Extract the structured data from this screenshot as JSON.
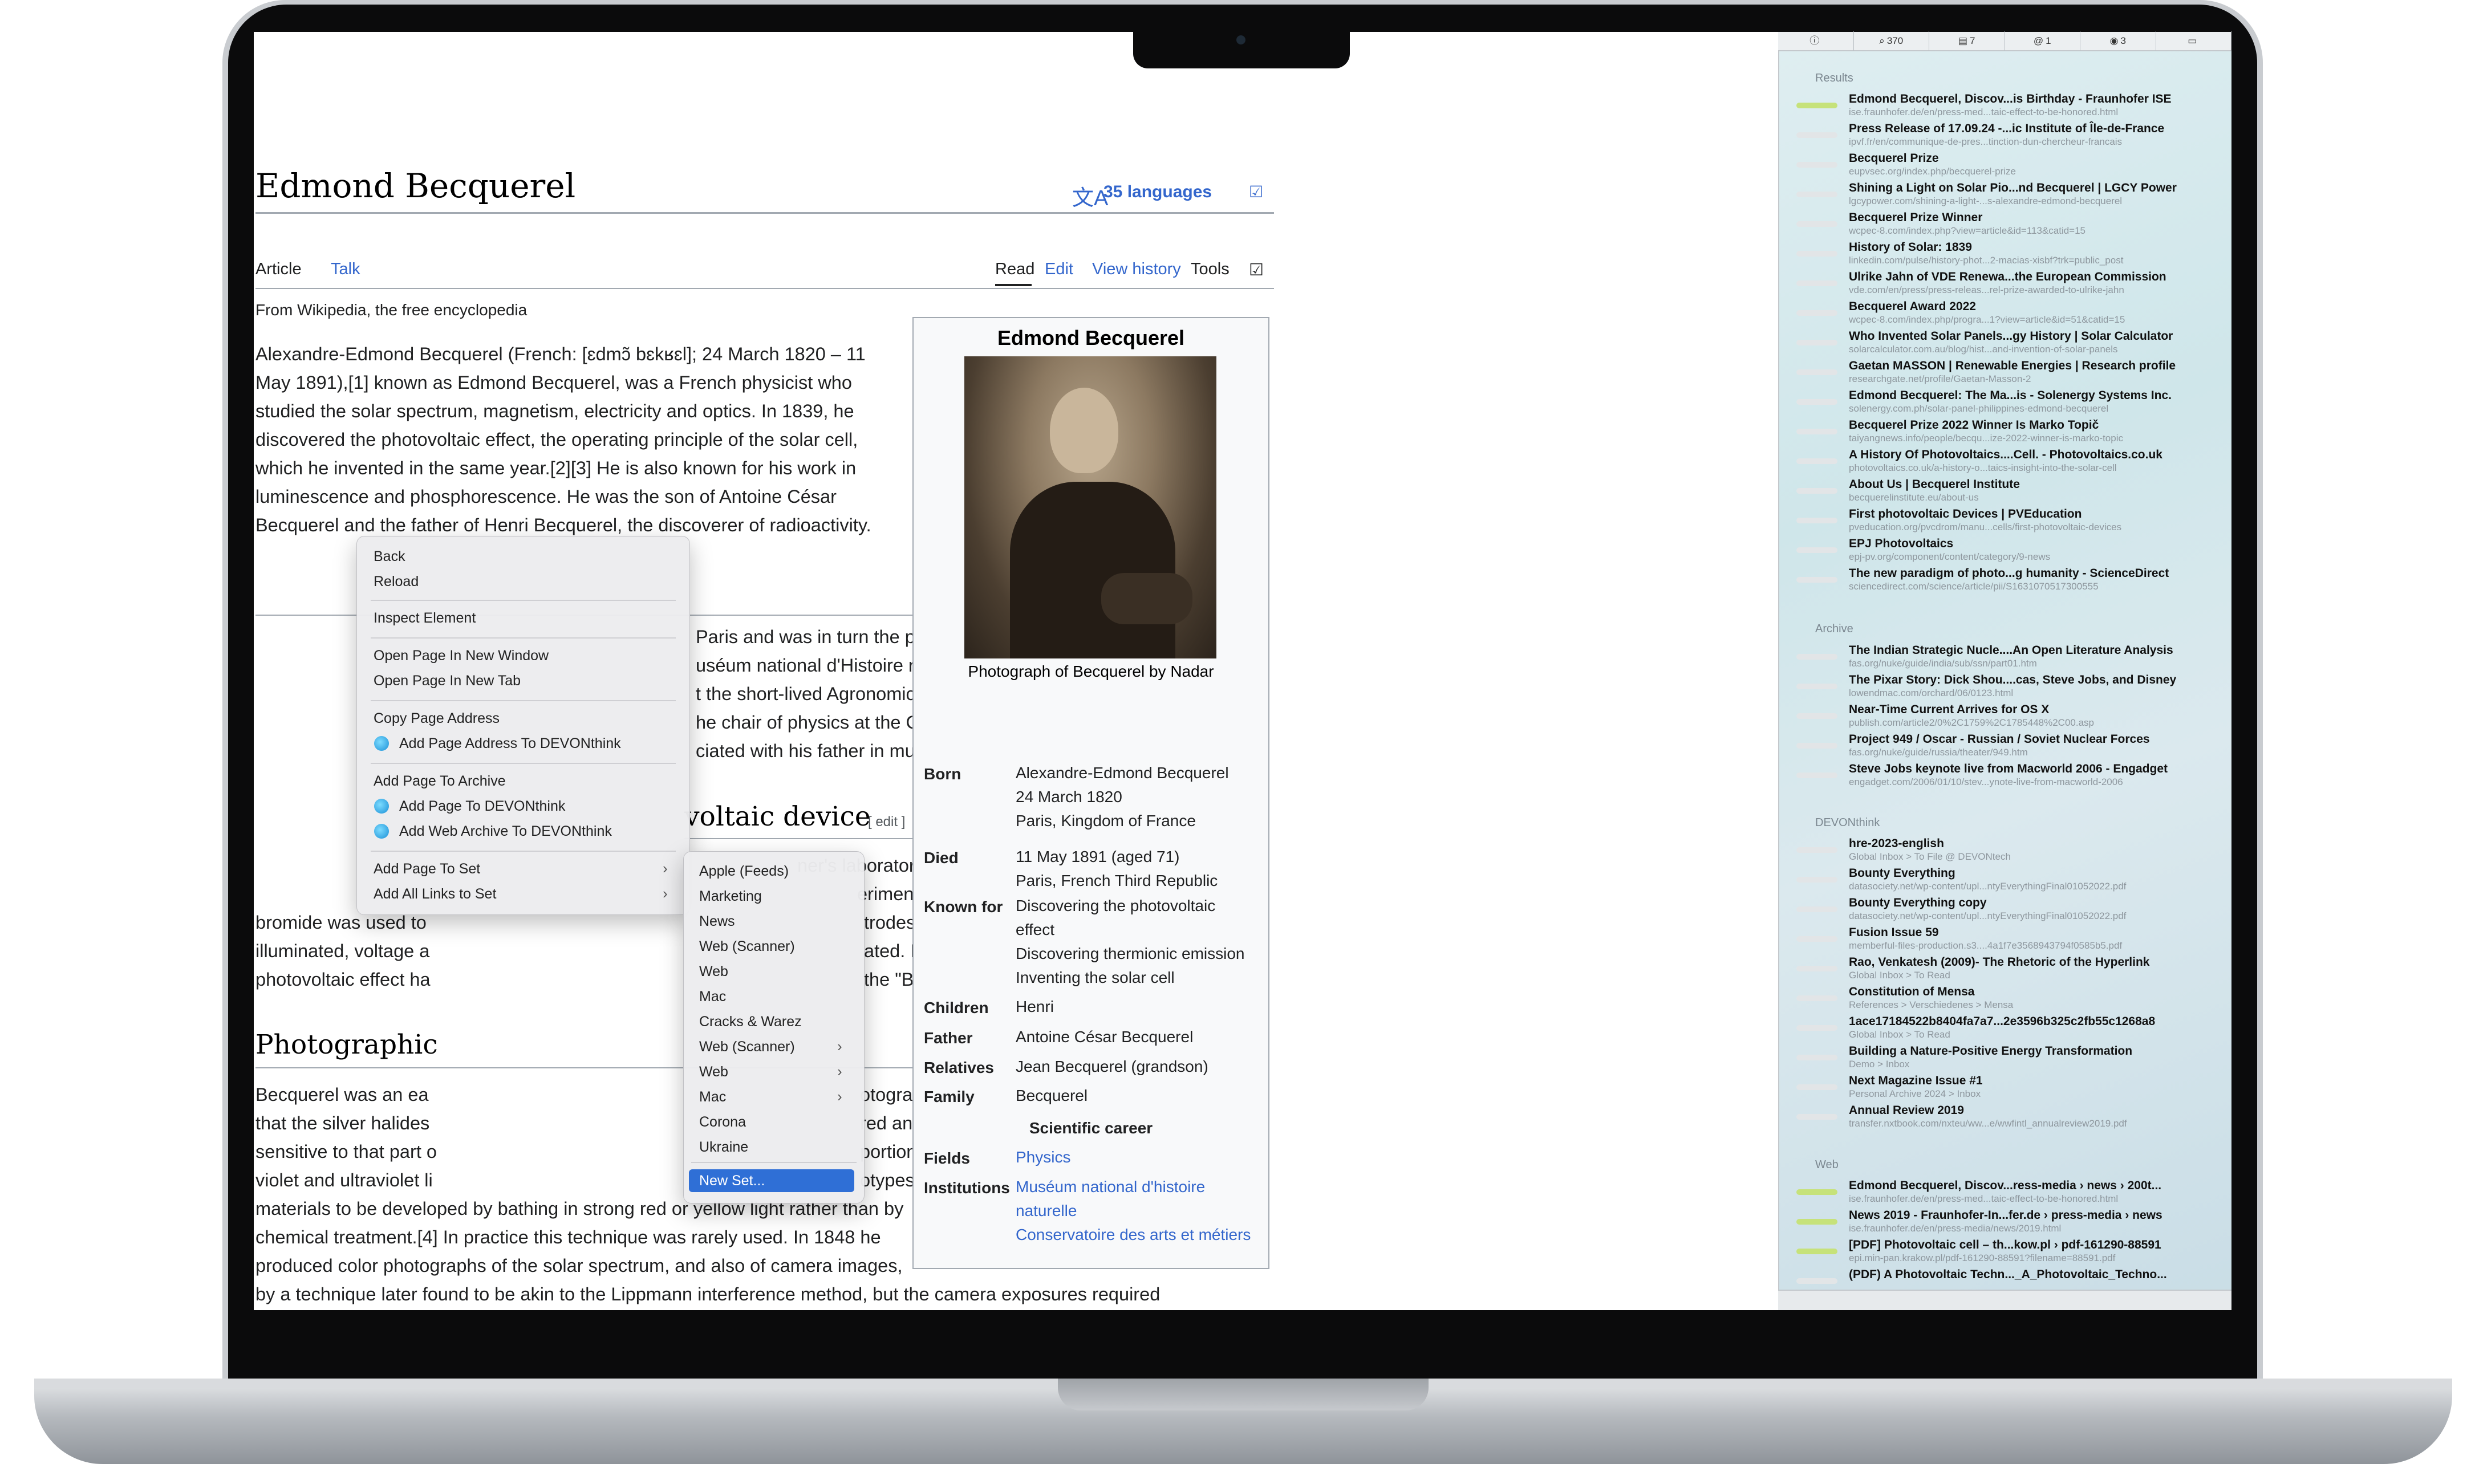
{
  "article": {
    "title": "Edmond Becquerel",
    "languages": "35 languages",
    "tabs_left": [
      "Article",
      "Talk"
    ],
    "tabs_right": [
      "Read",
      "Edit",
      "View history",
      "Tools"
    ],
    "from": "From Wikipedia, the free encyclopedia",
    "lead_lines": [
      "Alexandre-Edmond Becquerel (French: [ɛdmɔ̃ bɛkʁɛl]; 24 March 1820 – 11",
      "May 1891),[1] known as Edmond Becquerel, was a French physicist who",
      "studied the solar spectrum, magnetism, electricity and optics. In 1839, he",
      "discovered the photovoltaic effect, the operating principle of the solar cell,",
      "which he invented in the same year.[2][3] He is also known for his work in",
      "luminescence and phosphorescence. He was the son of Antoine César",
      "Becquerel and the father of Henri Becquerel, the discoverer of radioactivity."
    ],
    "bio_lines": [
      "Paris and was in turn the pupil, assistant and successor",
      "uséum national d'Histoire naturelle. He was also",
      "t the short-lived Agronomic Institute at Versailles in 1849,",
      "he chair of physics at the Conservatoire des Arts et",
      "ciated with his father in much of his work."
    ],
    "h2_device": "voltaic device",
    "edit_link": "[ edit ]",
    "device_lines": [
      "ner's laboratory, Becquerel created",
      "eriment, silver chloride or silver",
      "bromide was used to",
      "illuminated, voltage a",
      "photovoltaic effect ha"
    ],
    "device_right": [
      "trodes; once the electrodes were",
      "ated. Because of this work, the",
      "the \"Becquerel effect\"."
    ],
    "h2_photo": "Photographic",
    "photo_left": [
      "Becquerel was an ea",
      "that the silver halides",
      "sensitive to that part o",
      "violet and ultraviolet li",
      "materials to be developed by bathing in strong red or yellow light rather than by",
      "chemical treatment.[4] In practice this technique was rarely used. In 1848 he",
      "produced color photographs of the solar spectrum, and also of camera images,",
      "by a technique later found to be akin to the Lippmann interference method, but the camera exposures required were"
    ],
    "photo_right": [
      "otography. In 1840, he discovered",
      "red and yellow light, became",
      "portion to their exposure to blue,",
      "otypes and other photographic"
    ]
  },
  "infobox": {
    "title": "Edmond Becquerel",
    "caption": "Photograph of Becquerel by Nadar",
    "rows": [
      {
        "label": "Born",
        "value": [
          "Alexandre-Edmond Becquerel",
          "24 March 1820",
          "Paris, Kingdom of France"
        ]
      },
      {
        "label": "Died",
        "value": [
          "11 May 1891 (aged 71)",
          "Paris, French Third Republic"
        ]
      },
      {
        "label": "Known for",
        "value": [
          "Discovering the photovoltaic",
          "effect",
          "Discovering thermionic emission",
          "Inventing the solar cell"
        ]
      },
      {
        "label": "Children",
        "value": [
          "Henri"
        ]
      },
      {
        "label": "Father",
        "value": [
          "Antoine César Becquerel"
        ]
      },
      {
        "label": "Relatives",
        "value": [
          "Jean Becquerel (grandson)"
        ]
      },
      {
        "label": "Family",
        "value": [
          "Becquerel"
        ]
      }
    ],
    "career_header": "Scientific career",
    "career_rows": [
      {
        "label": "Fields",
        "value": [
          "Physics"
        ]
      },
      {
        "label": "Institutions",
        "value": [
          "Muséum national d'histoire",
          "naturelle",
          "Conservatoire des arts et métiers"
        ]
      }
    ]
  },
  "context_menu": {
    "items": [
      "Back",
      "Reload",
      "Inspect Element",
      "Open Page In New Window",
      "Open Page In New Tab",
      "Copy Page Address",
      "Add Page Address To DEVONthink",
      "Add Page To Archive",
      "Add Page To DEVONthink",
      "Add Web Archive To DEVONthink",
      "Add Page To Set",
      "Add All Links to Set"
    ]
  },
  "submenu": {
    "items": [
      "Apple (Feeds)",
      "Marketing",
      "News",
      "Web (Scanner)",
      "Web",
      "Mac",
      "Cracks & Warez",
      "Web (Scanner)",
      "Web",
      "Mac",
      "Corona",
      "Ukraine",
      "New Set..."
    ],
    "selected": "New Set..."
  },
  "sidebar": {
    "toolbar": [
      {
        "icon": "info-icon",
        "count": ""
      },
      {
        "icon": "search-icon",
        "count": "370"
      },
      {
        "icon": "archive-icon",
        "count": "7"
      },
      {
        "icon": "at-icon",
        "count": "1"
      },
      {
        "icon": "rss-icon",
        "count": "3"
      },
      {
        "icon": "trash-icon",
        "count": ""
      }
    ],
    "results_label": "Results",
    "results": [
      {
        "t": "Edmond Becquerel, Discov...is Birthday - Fraunhofer ISE",
        "u": "ise.fraunhofer.de/en/press-med...taic-effect-to-be-honored.html",
        "hl": true
      },
      {
        "t": "Press Release of 17.09.24 -...ic Institute of Île-de-France",
        "u": "ipvf.fr/en/communique-de-pres...tinction-dun-chercheur-francais",
        "hl": false
      },
      {
        "t": "Becquerel Prize",
        "u": "eupvsec.org/index.php/becquerel-prize",
        "hl": false
      },
      {
        "t": "Shining a Light on Solar Pio...nd Becquerel | LGCY Power",
        "u": "lgcypower.com/shining-a-light-...s-alexandre-edmond-becquerel",
        "hl": false
      },
      {
        "t": "Becquerel Prize Winner",
        "u": "wcpec-8.com/index.php?view=article&id=113&catid=15",
        "hl": false
      },
      {
        "t": "History of Solar: 1839",
        "u": "linkedin.com/pulse/history-phot...2-macias-xisbf?trk=public_post",
        "hl": false
      },
      {
        "t": "Ulrike Jahn of VDE Renewa...the European Commission",
        "u": "vde.com/en/press/press-releas...rel-prize-awarded-to-ulrike-jahn",
        "hl": false
      },
      {
        "t": "Becquerel Award 2022",
        "u": "wcpec-8.com/index.php/progra...1?view=article&id=51&catid=15",
        "hl": false
      },
      {
        "t": "Who Invented Solar Panels...gy History | Solar Calculator",
        "u": "solarcalculator.com.au/blog/hist...and-invention-of-solar-panels",
        "hl": false
      },
      {
        "t": "Gaetan MASSON | Renewable Energies | Research profile",
        "u": "researchgate.net/profile/Gaetan-Masson-2",
        "hl": false
      },
      {
        "t": "Edmond Becquerel: The Ma...is - Solenergy Systems Inc.",
        "u": "solenergy.com.ph/solar-panel-philippines-edmond-becquerel",
        "hl": false
      },
      {
        "t": "Becquerel Prize 2022 Winner Is Marko Topič",
        "u": "taiyangnews.info/people/becqu...ize-2022-winner-is-marko-topic",
        "hl": false
      },
      {
        "t": "A History Of Photovoltaics....Cell. - Photovoltaics.co.uk",
        "u": "photovoltaics.co.uk/a-history-o...taics-insight-into-the-solar-cell",
        "hl": false
      },
      {
        "t": "About Us | Becquerel Institute",
        "u": "becquerelinstitute.eu/about-us",
        "hl": false
      },
      {
        "t": "First photovoltaic Devices | PVEducation",
        "u": "pveducation.org/pvcdrom/manu...cells/first-photovoltaic-devices",
        "hl": false
      },
      {
        "t": "EPJ Photovoltaics",
        "u": "epj-pv.org/component/content/category/9-news",
        "hl": false
      },
      {
        "t": "The new paradigm of photo...g humanity - ScienceDirect",
        "u": "sciencedirect.com/science/article/pii/S1631070517300555",
        "hl": false
      }
    ],
    "archive_label": "Archive",
    "archive": [
      {
        "t": "The Indian Strategic Nucle....An Open Literature Analysis",
        "u": "fas.org/nuke/guide/india/sub/ssn/part01.htm",
        "hl": false
      },
      {
        "t": "The Pixar Story: Dick Shou....cas, Steve Jobs, and Disney",
        "u": "lowendmac.com/orchard/06/0123.html",
        "hl": false
      },
      {
        "t": "Near-Time Current Arrives for OS X",
        "u": "publish.com/article2/0%2C1759%2C1785448%2C00.asp",
        "hl": false
      },
      {
        "t": "Project 949 / Oscar - Russian / Soviet Nuclear Forces",
        "u": "fas.org/nuke/guide/russia/theater/949.htm",
        "hl": false
      },
      {
        "t": "Steve Jobs keynote live from Macworld 2006 - Engadget",
        "u": "engadget.com/2006/01/10/stev...ynote-live-from-macworld-2006",
        "hl": false
      }
    ],
    "devon_label": "DEVONthink",
    "devon": [
      {
        "t": "hre-2023-english",
        "u": "Global Inbox > To File @ DEVONtech",
        "hl": false
      },
      {
        "t": "Bounty Everything",
        "u": "datasociety.net/wp-content/upl...ntyEverythingFinal01052022.pdf",
        "hl": false
      },
      {
        "t": "Bounty Everything copy",
        "u": "datasociety.net/wp-content/upl...ntyEverythingFinal01052022.pdf",
        "hl": false
      },
      {
        "t": "Fusion Issue 59",
        "u": "memberful-files-production.s3....4a1f7e3568943794f0585b5.pdf",
        "hl": false
      },
      {
        "t": "Rao, Venkatesh (2009)- The Rhetoric of the Hyperlink",
        "u": "Global Inbox > To Read",
        "hl": false
      },
      {
        "t": "Constitution of Mensa",
        "u": "References > Verschiedenes > Mensa",
        "hl": false
      },
      {
        "t": "1ace17184522b8404fa7a7...2e3596b325c2fb55c1268a8",
        "u": "Global Inbox > To Read",
        "hl": false
      },
      {
        "t": "Building a Nature-Positive Energy Transformation",
        "u": "Demo > Inbox",
        "hl": false
      },
      {
        "t": "Next Magazine Issue #1",
        "u": "Personal Archive 2024 > Inbox",
        "hl": false
      },
      {
        "t": "Annual Review 2019",
        "u": "transfer.nxtbook.com/nxteu/ww...e/wwfintl_annualreview2019.pdf",
        "hl": false
      }
    ],
    "web_label": "Web",
    "web": [
      {
        "t": "Edmond Becquerel, Discov...ress-media › news › 200t...",
        "u": "ise.fraunhofer.de/en/press-med...taic-effect-to-be-honored.html",
        "hl": true
      },
      {
        "t": "News 2019 - Fraunhofer-In...fer.de › press-media › news",
        "u": "ise.fraunhofer.de/en/press-media/news/2019.html",
        "hl": true
      },
      {
        "t": "[PDF] Photovoltaic cell – th...kow.pl › pdf-161290-88591",
        "u": "epi.min-pan.krakow.pl/pdf-161290-88591?filename=88591.pdf",
        "hl": true
      },
      {
        "t": "(PDF) A Photovoltaic Techn..._A_Photovoltaic_Techno...",
        "u": "",
        "hl": false
      }
    ]
  }
}
